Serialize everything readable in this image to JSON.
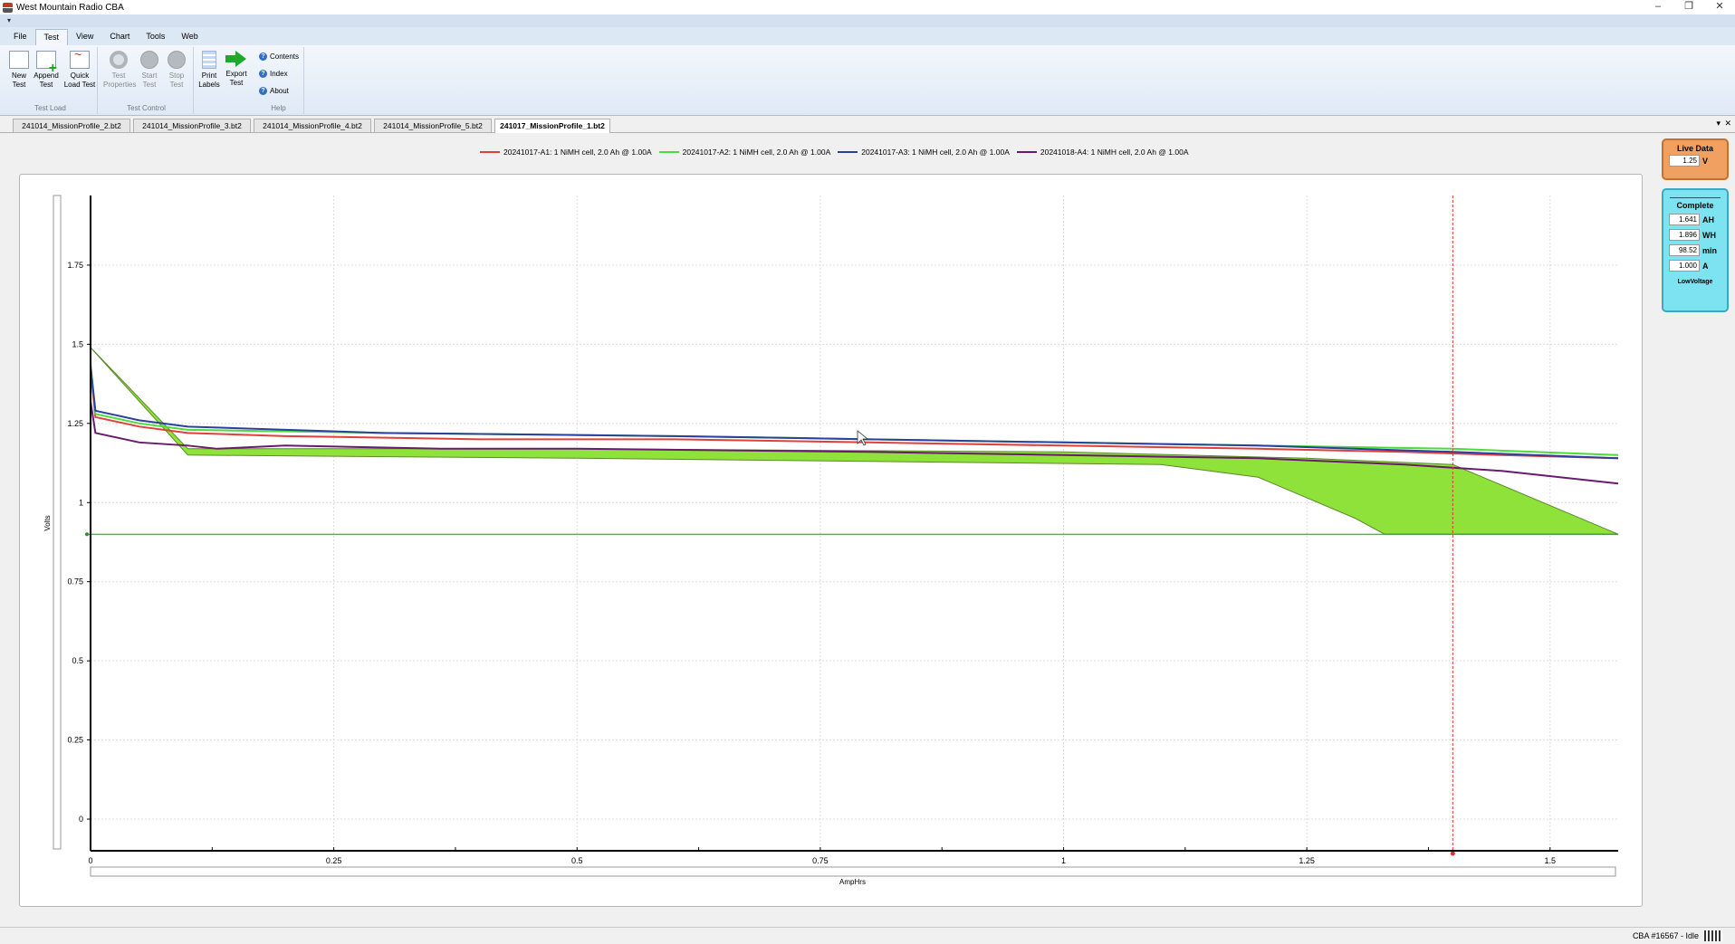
{
  "window": {
    "title": "West Mountain Radio CBA",
    "controls": [
      "–",
      "❐",
      "✕"
    ],
    "qat": "▾"
  },
  "menu": [
    "File",
    "Test",
    "View",
    "Chart",
    "Tools",
    "Web"
  ],
  "ribbon": {
    "groups": {
      "test_load": "Test Load",
      "test_control": "Test Control",
      "help": "Help"
    },
    "buttons": {
      "new_test": "New Test",
      "append_test": "Append Test",
      "quick_load": "Quick Load Test",
      "test_properties": "Test Properties",
      "start_test": "Start Test",
      "stop_test": "Stop Test",
      "print_labels": "Print Labels",
      "export_test": "Export Test"
    },
    "help": [
      "Contents",
      "Index",
      "About"
    ]
  },
  "file_tabs": [
    "241014_MissionProfile_2.bt2",
    "241014_MissionProfile_3.bt2",
    "241014_MissionProfile_4.bt2",
    "241014_MissionProfile_5.bt2",
    "241017_MissionProfile_1.bt2"
  ],
  "tab_controls": {
    "dropdown": "▾",
    "close": "✕"
  },
  "live_data": {
    "title": "Live Data",
    "value": "1.25",
    "unit": "V"
  },
  "complete": {
    "title": "Complete",
    "rows": [
      {
        "value": "1.641",
        "unit": "AH"
      },
      {
        "value": "1.896",
        "unit": "WH"
      },
      {
        "value": "98.52",
        "unit": "min"
      },
      {
        "value": "1.000",
        "unit": "A"
      }
    ],
    "status": "LowVoltage"
  },
  "status_bar": "CBA #16567 - Idle",
  "chart_data": {
    "type": "line",
    "xlabel": "AmpHrs",
    "ylabel": "Volts",
    "xlim": [
      0,
      1.57
    ],
    "ylim": [
      -0.1,
      1.97
    ],
    "x_ticks": [
      0,
      0.25,
      0.5,
      0.75,
      1,
      1.25,
      1.5
    ],
    "x_tick_labels": [
      "0",
      "0.25",
      "0.5",
      "0.75",
      "1",
      "1.25",
      "1.5"
    ],
    "y_ticks": [
      0,
      0.25,
      0.5,
      0.75,
      1,
      1.25,
      1.5,
      1.75
    ],
    "y_tick_labels": [
      "0",
      "0.25",
      "0.5",
      "0.75",
      "1",
      "1.25",
      "1.5",
      "1.75"
    ],
    "grid": true,
    "cutoff_voltage": 0.9,
    "marker_x": 1.4,
    "series": [
      {
        "name": "20241017-A1: 1 NiMH cell, 2.0 Ah @ 1.00A",
        "color": "#e0403a",
        "x": [
          0,
          0.005,
          0.05,
          0.1,
          0.2,
          0.4,
          0.6,
          0.8,
          1.0,
          1.2,
          1.35,
          1.45,
          1.57
        ],
        "y": [
          1.42,
          1.27,
          1.24,
          1.22,
          1.21,
          1.2,
          1.2,
          1.19,
          1.18,
          1.17,
          1.16,
          1.15,
          1.14
        ]
      },
      {
        "name": "20241017-A2: 1 NiMH cell, 2.0 Ah @ 1.00A",
        "color": "#4cdc3a",
        "x": [
          0,
          0.005,
          0.05,
          0.1,
          0.3,
          0.6,
          0.8,
          1.0,
          1.2,
          1.4,
          1.57
        ],
        "y": [
          1.44,
          1.28,
          1.25,
          1.23,
          1.22,
          1.21,
          1.2,
          1.19,
          1.18,
          1.17,
          1.15
        ]
      },
      {
        "name": "20241017-A3: 1 NiMH cell, 2.0 Ah @ 1.00A",
        "color": "#2a3f9e",
        "x": [
          0,
          0.005,
          0.05,
          0.1,
          0.3,
          0.6,
          0.8,
          1.0,
          1.2,
          1.4,
          1.57
        ],
        "y": [
          1.43,
          1.29,
          1.26,
          1.24,
          1.22,
          1.21,
          1.2,
          1.19,
          1.18,
          1.16,
          1.14
        ]
      },
      {
        "name": "20241018-A4: 1 NiMH cell, 2.0 Ah @ 1.00A",
        "color": "#6a1a6e",
        "x": [
          0,
          0.005,
          0.05,
          0.1,
          0.13,
          0.2,
          0.36,
          0.5,
          0.8,
          1.0,
          1.2,
          1.35,
          1.45,
          1.57
        ],
        "y": [
          1.32,
          1.22,
          1.19,
          1.18,
          1.17,
          1.18,
          1.17,
          1.17,
          1.16,
          1.15,
          1.14,
          1.12,
          1.1,
          1.06
        ]
      }
    ],
    "mission_profile_band": {
      "color": "#8ee23a",
      "upper": {
        "x": [
          0,
          0.1,
          0.5,
          1.0,
          1.25,
          1.4,
          1.57
        ],
        "y": [
          1.49,
          1.17,
          1.17,
          1.16,
          1.14,
          1.12,
          0.9
        ]
      },
      "lower": {
        "x": [
          0,
          0.1,
          0.5,
          0.8,
          1.1,
          1.2,
          1.3,
          1.33
        ],
        "y": [
          1.49,
          1.15,
          1.14,
          1.13,
          1.12,
          1.08,
          0.95,
          0.9
        ]
      }
    }
  }
}
